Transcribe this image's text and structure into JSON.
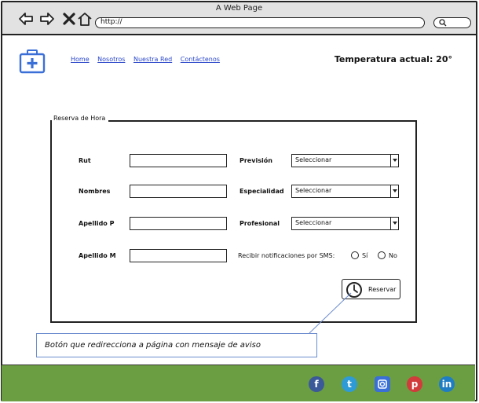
{
  "window": {
    "title": "A Web Page",
    "url": "http://"
  },
  "icons": {
    "back": "arrow-left-icon",
    "forward": "arrow-right-icon",
    "stop": "close-icon",
    "home": "home-icon",
    "search": "search-icon",
    "logo": "medical-kit-icon",
    "reserve": "clock-icon"
  },
  "nav": {
    "items": [
      {
        "label": "Home"
      },
      {
        "label": "Nosotros"
      },
      {
        "label": "Nuestra Red"
      },
      {
        "label": "Contáctenos"
      }
    ],
    "temperature": "Temperatura actual: 20°"
  },
  "form": {
    "legend": "Reserva de Hora",
    "fields": {
      "rut": "Rut",
      "nombres": "Nombres",
      "apellido_p": "Apellido P",
      "apellido_m": "Apellido M"
    },
    "selects": {
      "prevision": {
        "label": "Previsión",
        "value": "Seleccionar"
      },
      "especialidad": {
        "label": "Especialidad",
        "value": "Seleccionar"
      },
      "profesional": {
        "label": "Profesional",
        "value": "Seleccionar"
      }
    },
    "sms": {
      "label": "Recibir notificaciones por SMS:",
      "options": [
        "Sí",
        "No"
      ]
    },
    "reserve_label": "Reservar"
  },
  "callout": "Botón que redirecciona a página con mensaje de aviso",
  "footer": {
    "social": [
      "facebook-icon",
      "twitter-icon",
      "instagram-icon",
      "pinterest-icon",
      "linkedin-icon"
    ]
  },
  "colors": {
    "link": "#2a47c9",
    "footer": "#6b9d42",
    "logo": "#3a6fd8",
    "callout_border": "#6b8cd0",
    "facebook": "#3b5998",
    "twitter": "#2f9bd6",
    "instagram": "#3a6fd8",
    "pinterest": "#d23b3b",
    "linkedin": "#1f7dc4"
  }
}
